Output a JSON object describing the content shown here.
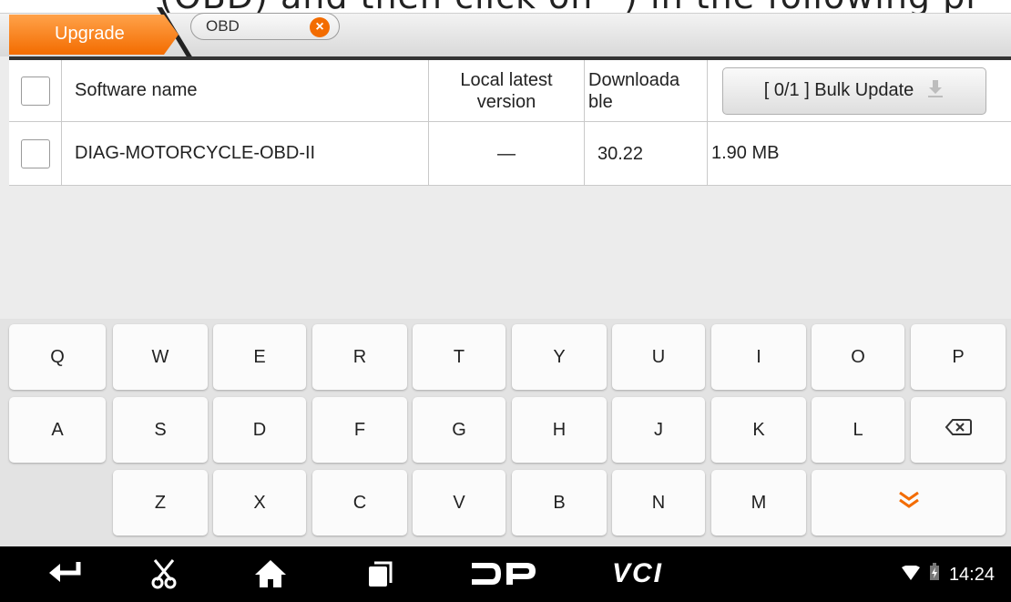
{
  "header": {
    "bg_caption": "(OBD) and then click on ”) in the following pi",
    "tab_label": "Upgrade",
    "search_value": "OBD"
  },
  "table": {
    "col_software": "Software name",
    "col_local": "Local latest version",
    "col_download": "Downloada ble",
    "bulk_update": "[ 0/1 ] Bulk Update",
    "rows": [
      {
        "name": "DIAG-MOTORCYCLE-OBD-II",
        "local": "—",
        "download": "30.22",
        "size": "1.90 MB"
      }
    ]
  },
  "keyboard": {
    "row1": [
      "Q",
      "W",
      "E",
      "R",
      "T",
      "Y",
      "U",
      "I",
      "O",
      "P"
    ],
    "row2": [
      "A",
      "S",
      "D",
      "F",
      "G",
      "H",
      "J",
      "K",
      "L"
    ],
    "row3": [
      "Z",
      "X",
      "C",
      "V",
      "B",
      "N",
      "M"
    ]
  },
  "navbar": {
    "logo_text": "VCI",
    "time": "14:24"
  },
  "colors": {
    "accent": "#f36c00",
    "nav_bg": "#000000"
  }
}
